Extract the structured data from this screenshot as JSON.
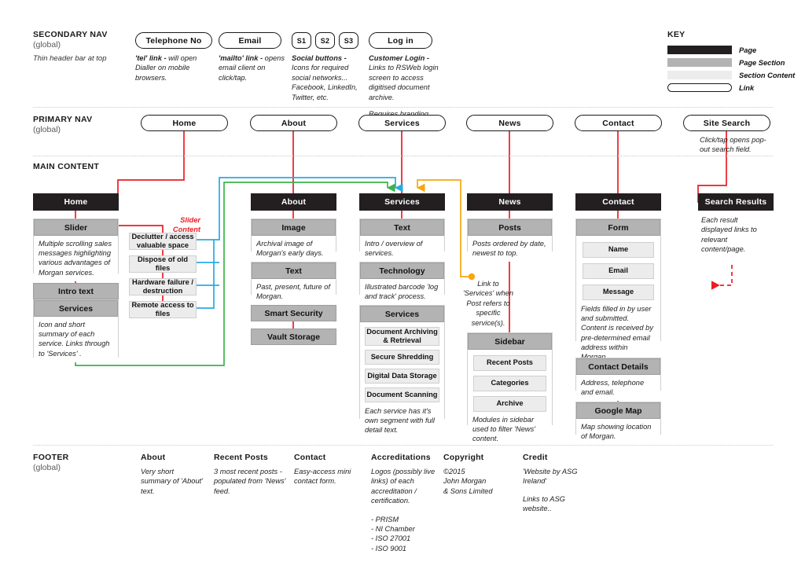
{
  "colors": {
    "page": "#231f20",
    "page_section": "#b3b3b3",
    "section_content": "#ececec",
    "link_border": "#1a1a1a",
    "red": "#ed1c24",
    "blue": "#29abe2",
    "green": "#39b54a",
    "orange": "#f7a711"
  },
  "secondary_nav": {
    "title": "SECONDARY NAV",
    "scope": "(global)",
    "note": "Thin header bar at top",
    "buttons": [
      {
        "label": "Telephone No"
      },
      {
        "label": "Email"
      },
      {
        "label": "S1"
      },
      {
        "label": "S2"
      },
      {
        "label": "S3"
      },
      {
        "label": "Log in"
      }
    ],
    "annotations": [
      {
        "lead": "'tel' link -",
        "body": "will open Dialler on mobile browsers."
      },
      {
        "lead": "'mailto' link -",
        "body": "opens email client on click/tap."
      },
      {
        "lead": "Social buttons -",
        "body": "Icons for required social networks... Facebook, LinkedIn, Twitter, etc."
      },
      {
        "lead": "Customer Login -",
        "body": "Links to RSWeb login screen to access digitised document archive.",
        "body2": "Requires branding."
      }
    ]
  },
  "key": {
    "title": "KEY",
    "items": [
      {
        "label": "Page",
        "swatch": "page"
      },
      {
        "label": "Page Section",
        "swatch": "page_section"
      },
      {
        "label": "Section Content",
        "swatch": "section_content"
      },
      {
        "label": "Link",
        "swatch": "link"
      }
    ]
  },
  "primary_nav": {
    "title": "PRIMARY NAV",
    "scope": "(global)",
    "items": [
      {
        "label": "Home"
      },
      {
        "label": "About"
      },
      {
        "label": "Services"
      },
      {
        "label": "News"
      },
      {
        "label": "Contact"
      },
      {
        "label": "Site Search"
      }
    ],
    "search_note": "Click/tap opens pop-out search field."
  },
  "main_content": {
    "title": "MAIN CONTENT",
    "columns": {
      "home": {
        "page": "Home",
        "slider": {
          "title": "Slider",
          "desc": "Multiple scrolling sales messages highlighting various advantages of Morgan services."
        },
        "intro": {
          "title": "Intro text"
        },
        "services": {
          "title": "Services",
          "desc": "Icon and short summary of each service. Links through to 'Services' ."
        },
        "slider_content_label": "Slider\nContent",
        "slider_content_label_l1": "Slider",
        "slider_content_label_l2": "Content",
        "slider_items": [
          "Declutter / access valuable space",
          "Dispose of old files",
          "Hardware failure / destruction",
          "Remote access to files"
        ]
      },
      "about": {
        "page": "About",
        "sections": [
          {
            "title": "Image",
            "desc": "Archival image of Morgan's early days."
          },
          {
            "title": "Text",
            "desc": "Past, present, future of Morgan."
          },
          {
            "title": "Smart Security"
          },
          {
            "title": "Vault Storage"
          }
        ]
      },
      "services": {
        "page": "Services",
        "sections": [
          {
            "title": "Text",
            "desc": "Intro / overview of services."
          },
          {
            "title": "Technology",
            "desc": "Illustrated barcode 'log and track' process."
          },
          {
            "title": "Services"
          }
        ],
        "service_items": [
          "Document Archiving & Retrieval",
          "Secure Shredding",
          "Digital Data Storage",
          "Document Scanning"
        ],
        "service_note": "Each service has it's own segment with full detail text."
      },
      "news": {
        "page": "News",
        "posts": {
          "title": "Posts",
          "desc": "Posts ordered by date, newest to top."
        },
        "link_note": "Link to 'Services' when Post refers to specific service(s).",
        "sidebar": {
          "title": "Sidebar",
          "note": "Modules in sidebar used to filter 'News' content."
        },
        "sidebar_items": [
          "Recent Posts",
          "Categories",
          "Archive"
        ]
      },
      "contact": {
        "page": "Contact",
        "form": {
          "title": "Form",
          "desc": "Fields filled in by user and submitted. Content is received by pre-determined email address within Morgan."
        },
        "form_fields": [
          "Name",
          "Email",
          "Message"
        ],
        "details": {
          "title": "Contact Details",
          "desc": "Address, telephone and email."
        },
        "map": {
          "title": "Google Map",
          "desc": "Map showing location of Morgan."
        }
      },
      "search": {
        "page": "Search Results",
        "desc": "Each result displayed links to relevant content/page."
      }
    }
  },
  "footer": {
    "title": "FOOTER",
    "scope": "(global)",
    "columns": [
      {
        "heading": "About",
        "text": "Very short summary of 'About' text."
      },
      {
        "heading": "Recent Posts",
        "text": "3 most recent posts - populated from 'News' feed."
      },
      {
        "heading": "Contact",
        "text": "Easy-access mini contact form."
      },
      {
        "heading": "Accreditations",
        "text": "Logos (possibly live links) of each accreditation / certification.",
        "list": "- PRISM\n- NI Chamber\n- ISO 27001\n- ISO 9001"
      },
      {
        "heading": "Copyright",
        "text": "©2015\nJohn Morgan\n& Sons Limited"
      },
      {
        "heading": "Credit",
        "text": "'Website by ASG Ireland'",
        "text2": "Links to ASG website.."
      }
    ]
  }
}
